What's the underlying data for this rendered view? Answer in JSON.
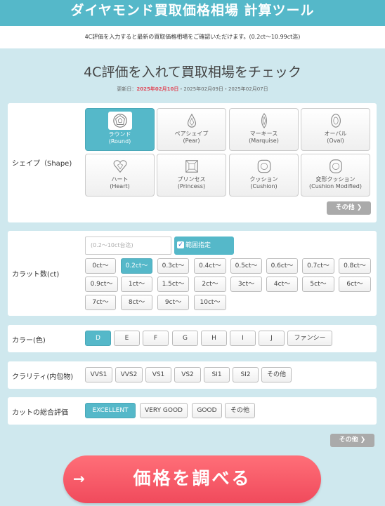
{
  "header": {
    "title": "ダイヤモンド買取価格相場 計算ツール",
    "subtitle": "4C評価を入力すると最新の買取価格相場をご確認いただけます。(0.2ct〜10.99ct迄)"
  },
  "main": {
    "heading": "4C評価を入れて買取相場をチェック",
    "updated_label": "更新日：",
    "updated_latest": "2025年02月10日",
    "updated_rest": "・2025年02月09日・2025年02月07日"
  },
  "shape": {
    "label": "シェイプ（Shape)",
    "selected": "ラウンド",
    "options": [
      {
        "jp": "ラウンド",
        "en": "(Round)",
        "icon": "round-brilliant-icon"
      },
      {
        "jp": "ペアシェイプ",
        "en": "(Pear)",
        "icon": "pear-icon"
      },
      {
        "jp": "マーキース",
        "en": "(Marquise)",
        "icon": "marquise-icon"
      },
      {
        "jp": "オーバル",
        "en": "(Oval)",
        "icon": "oval-icon"
      },
      {
        "jp": "ハート",
        "en": "(Heart)",
        "icon": "heart-icon"
      },
      {
        "jp": "プリンセス",
        "en": "(Princess)",
        "icon": "princess-icon"
      },
      {
        "jp": "クッション",
        "en": "(Cushion)",
        "icon": "cushion-icon"
      },
      {
        "jp": "変形クッション",
        "en": "(Cushion Modified)",
        "icon": "cushion-modified-icon"
      }
    ],
    "more_label": "その他 ❯"
  },
  "carat": {
    "label": "カラット数(ct)",
    "placeholder": "(0.2〜10ct台迄)",
    "range_label": "範囲指定",
    "range_checked": true,
    "selected": "0.2ct〜",
    "options": [
      "0ct〜",
      "0.2ct〜",
      "0.3ct〜",
      "0.4ct〜",
      "0.5ct〜",
      "0.6ct〜",
      "0.7ct〜",
      "0.8ct〜",
      "0.9ct〜",
      "1ct〜",
      "1.5ct〜",
      "2ct〜",
      "3ct〜",
      "4ct〜",
      "5ct〜",
      "6ct〜",
      "7ct〜",
      "8ct〜",
      "9ct〜",
      "10ct〜"
    ]
  },
  "color": {
    "label": "カラー(色)",
    "selected": "D",
    "options": [
      "D",
      "E",
      "F",
      "G",
      "H",
      "I",
      "J",
      "ファンシー"
    ]
  },
  "clarity": {
    "label": "クラリティ(内包物)",
    "options": [
      "VVS1",
      "VVS2",
      "VS1",
      "VS2",
      "SI1",
      "SI2",
      "その他"
    ]
  },
  "cut": {
    "label": "カットの総合評価",
    "selected": "EXCELLENT",
    "options": [
      "EXCELLENT",
      "VERY GOOD",
      "GOOD",
      "その他"
    ]
  },
  "other_more_label": "その他 ❯",
  "search": {
    "arrow": "→",
    "label": "価格を調べる"
  },
  "colors": {
    "accent": "#55b8c9",
    "search_button": "#f04a5c",
    "background": "#cfe8ee"
  }
}
